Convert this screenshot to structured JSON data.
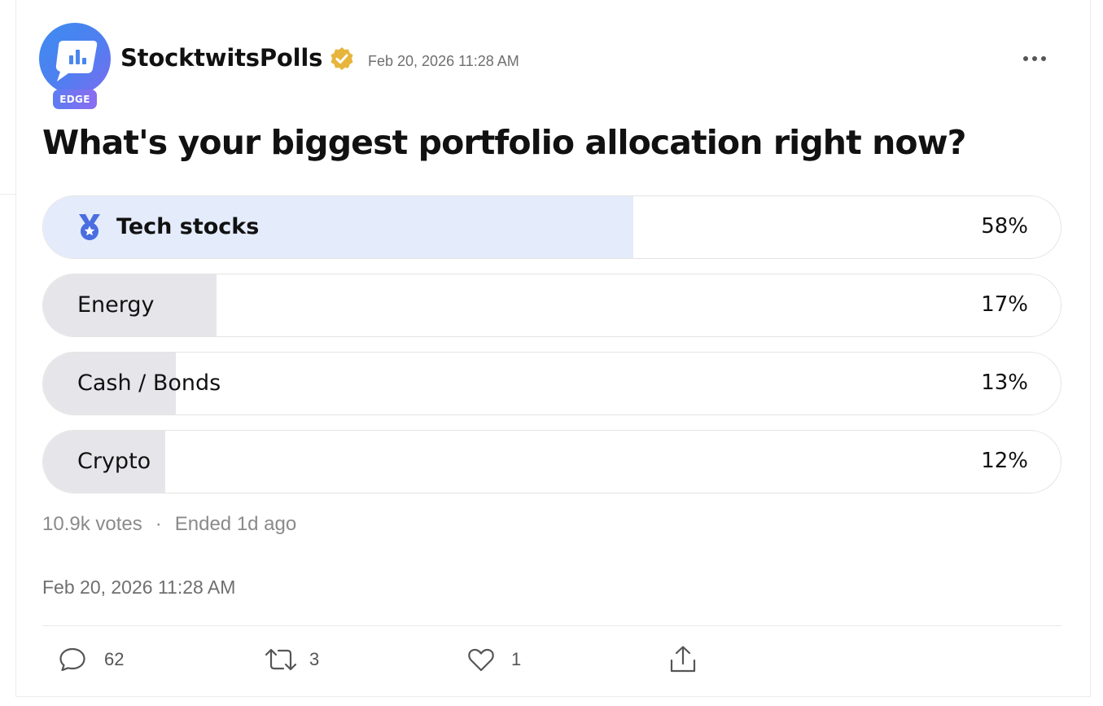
{
  "header": {
    "author": "StocktwitsPolls",
    "badge": "EDGE",
    "post_time": "Feb 20, 2026 11:28 AM"
  },
  "poll": {
    "question": "What's your biggest portfolio allocation right now?",
    "options": [
      {
        "label": "Tech stocks",
        "percent_label": "58%",
        "percent": 58,
        "winner": true
      },
      {
        "label": "Energy",
        "percent_label": "17%",
        "percent": 17,
        "winner": false
      },
      {
        "label": "Cash / Bonds",
        "percent_label": "13%",
        "percent": 13,
        "winner": false
      },
      {
        "label": "Crypto",
        "percent_label": "12%",
        "percent": 12,
        "winner": false
      }
    ],
    "votes": "10.9k votes",
    "separator": "·",
    "status": "Ended 1d ago"
  },
  "timestamp": "Feb 20, 2026 11:28 AM",
  "actions": {
    "comments": "62",
    "reposts": "3",
    "likes": "1"
  },
  "colors": {
    "winner_fill": "#e4ebfb",
    "option_fill": "#e6e6ea",
    "verified": "#e7b53c",
    "medal": "#4a6ee0",
    "avatar_gradient_start": "#3d8cf0",
    "avatar_gradient_end": "#7a6cf0"
  },
  "icons": {
    "avatar": "poll-chart-bubble-icon",
    "verified": "verified-check-icon",
    "more": "more-horizontal-icon",
    "winner": "medal-icon",
    "comment": "comment-bubble-icon",
    "repost": "repost-icon",
    "like": "heart-icon",
    "share": "share-upload-icon"
  }
}
